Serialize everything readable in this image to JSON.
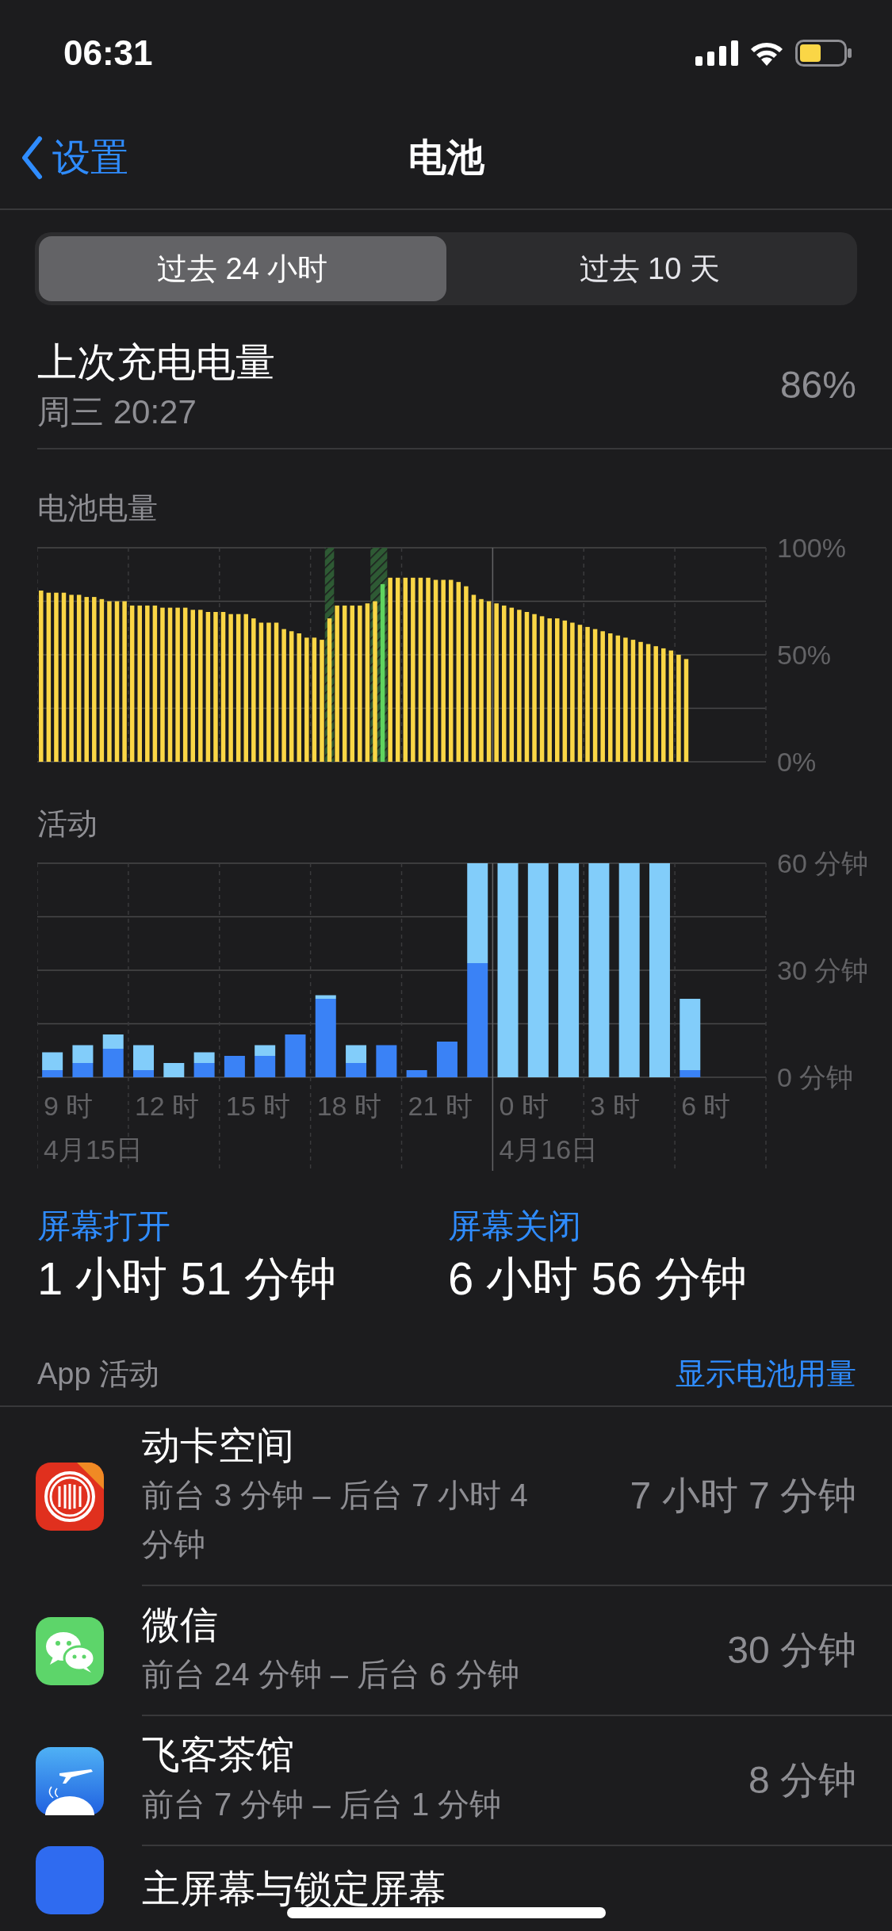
{
  "status_bar": {
    "time": "06:31"
  },
  "nav": {
    "back": "设置",
    "title": "电池"
  },
  "segments": [
    {
      "label": "过去 24 小时",
      "selected": true
    },
    {
      "label": "过去 10 天",
      "selected": false
    }
  ],
  "last_charge": {
    "title": "上次充电电量",
    "time": "周三 20:27",
    "value": "86%"
  },
  "battery_chart": {
    "chart_data": {
      "type": "bar",
      "title": "电池电量",
      "ylim": [
        0,
        100
      ],
      "yticks": [
        {
          "value": 0,
          "label": "0%"
        },
        {
          "value": 50,
          "label": "50%"
        },
        {
          "value": 100,
          "label": "100%"
        }
      ],
      "series": [
        {
          "color": "#fad646",
          "values": [
            80,
            79,
            79,
            79,
            78,
            78,
            77,
            77,
            76,
            75,
            75,
            75,
            73,
            73,
            73,
            73,
            72,
            72,
            72,
            72,
            71,
            71,
            70,
            70,
            70,
            69,
            69,
            69,
            67,
            65,
            65,
            65,
            62,
            61,
            60,
            58,
            58,
            57,
            67,
            73,
            73,
            73,
            73,
            74,
            75,
            null,
            86,
            86,
            86,
            86,
            86,
            86,
            85,
            85,
            85,
            84,
            82,
            78,
            76,
            75,
            74,
            73,
            72,
            71,
            70,
            69,
            68,
            67,
            67,
            66,
            65,
            64,
            63,
            62,
            61,
            60,
            59,
            58,
            57,
            56,
            55,
            54,
            53,
            52,
            50,
            48,
            null,
            null,
            null,
            null,
            null,
            null,
            null,
            null,
            null,
            null
          ]
        },
        {
          "color": "#5fd35f",
          "values": [
            null,
            null,
            null,
            null,
            null,
            null,
            null,
            null,
            null,
            null,
            null,
            null,
            null,
            null,
            null,
            null,
            null,
            null,
            null,
            null,
            null,
            null,
            null,
            null,
            null,
            null,
            null,
            null,
            null,
            null,
            null,
            null,
            null,
            null,
            null,
            null,
            null,
            null,
            null,
            null,
            null,
            null,
            null,
            null,
            null,
            83,
            null,
            null,
            null,
            null,
            null,
            null,
            null,
            null,
            null,
            null,
            null,
            null,
            null,
            null,
            null,
            null,
            null,
            null,
            null,
            null,
            null,
            null,
            null,
            null,
            null,
            null,
            null,
            null,
            null,
            null,
            null,
            null,
            null,
            null,
            null,
            null,
            null,
            null,
            null,
            null,
            null,
            null,
            null,
            null,
            null,
            null,
            null,
            null,
            null,
            null
          ]
        }
      ]
    }
  },
  "activity_chart": {
    "hour_labels": [
      "9 时",
      "12 时",
      "15 时",
      "18 时",
      "21 时",
      "0 时",
      "3 时",
      "6 时"
    ],
    "dates": [
      "4月15日",
      "4月16日"
    ],
    "chart_data": {
      "type": "bar",
      "title": "活动",
      "stacked": true,
      "ylim": [
        0,
        60
      ],
      "yticks": [
        {
          "value": 0,
          "label": "0 分钟"
        },
        {
          "value": 30,
          "label": "30 分钟"
        },
        {
          "value": 60,
          "label": "60 分钟"
        }
      ],
      "series": [
        {
          "color": "#3a82f6",
          "values": [
            2,
            4,
            8,
            2,
            0,
            4,
            6,
            6,
            12,
            22,
            4,
            9,
            2,
            10,
            32,
            0,
            0,
            0,
            0,
            0,
            0,
            2,
            null,
            null
          ]
        },
        {
          "color": "#82cdfa",
          "values": [
            5,
            5,
            4,
            7,
            4,
            3,
            0,
            3,
            0,
            1,
            5,
            0,
            0,
            0,
            28,
            60,
            60,
            60,
            60,
            60,
            60,
            20,
            null,
            null
          ]
        }
      ]
    }
  },
  "screen_stats": [
    {
      "label": "屏幕打开",
      "value": "1 小时 51 分钟"
    },
    {
      "label": "屏幕关闭",
      "value": "6 小时 56 分钟"
    }
  ],
  "app_activity": {
    "title": "App 活动",
    "action": "显示电池用量",
    "apps": [
      {
        "kind": "bank",
        "name": "动卡空间",
        "detail": "前台 3 分钟 – 后台 7 小时 4 分钟",
        "time": "7 小时 7 分钟"
      },
      {
        "kind": "chat",
        "name": "微信",
        "detail": "前台 24 分钟 – 后台 6 分钟",
        "time": "30 分钟"
      },
      {
        "kind": "plane",
        "name": "飞客茶馆",
        "detail": "前台 7 分钟 – 后台 1 分钟",
        "time": "8 分钟"
      },
      {
        "kind": "home",
        "name": "主屏幕与锁定屏幕"
      }
    ]
  }
}
